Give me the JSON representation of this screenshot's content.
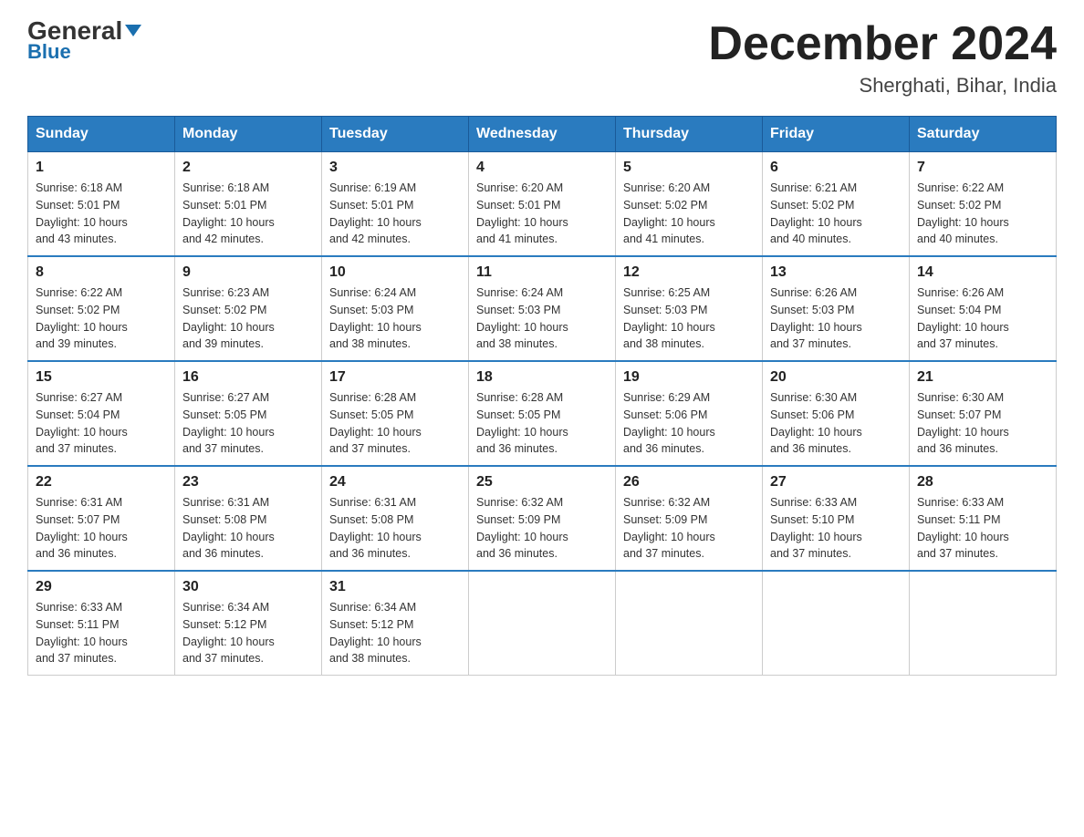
{
  "logo": {
    "general": "General",
    "blue": "Blue"
  },
  "title": "December 2024",
  "location": "Sherghati, Bihar, India",
  "weekdays": [
    "Sunday",
    "Monday",
    "Tuesday",
    "Wednesday",
    "Thursday",
    "Friday",
    "Saturday"
  ],
  "weeks": [
    [
      {
        "day": "1",
        "sunrise": "6:18 AM",
        "sunset": "5:01 PM",
        "daylight": "10 hours and 43 minutes."
      },
      {
        "day": "2",
        "sunrise": "6:18 AM",
        "sunset": "5:01 PM",
        "daylight": "10 hours and 42 minutes."
      },
      {
        "day": "3",
        "sunrise": "6:19 AM",
        "sunset": "5:01 PM",
        "daylight": "10 hours and 42 minutes."
      },
      {
        "day": "4",
        "sunrise": "6:20 AM",
        "sunset": "5:01 PM",
        "daylight": "10 hours and 41 minutes."
      },
      {
        "day": "5",
        "sunrise": "6:20 AM",
        "sunset": "5:02 PM",
        "daylight": "10 hours and 41 minutes."
      },
      {
        "day": "6",
        "sunrise": "6:21 AM",
        "sunset": "5:02 PM",
        "daylight": "10 hours and 40 minutes."
      },
      {
        "day": "7",
        "sunrise": "6:22 AM",
        "sunset": "5:02 PM",
        "daylight": "10 hours and 40 minutes."
      }
    ],
    [
      {
        "day": "8",
        "sunrise": "6:22 AM",
        "sunset": "5:02 PM",
        "daylight": "10 hours and 39 minutes."
      },
      {
        "day": "9",
        "sunrise": "6:23 AM",
        "sunset": "5:02 PM",
        "daylight": "10 hours and 39 minutes."
      },
      {
        "day": "10",
        "sunrise": "6:24 AM",
        "sunset": "5:03 PM",
        "daylight": "10 hours and 38 minutes."
      },
      {
        "day": "11",
        "sunrise": "6:24 AM",
        "sunset": "5:03 PM",
        "daylight": "10 hours and 38 minutes."
      },
      {
        "day": "12",
        "sunrise": "6:25 AM",
        "sunset": "5:03 PM",
        "daylight": "10 hours and 38 minutes."
      },
      {
        "day": "13",
        "sunrise": "6:26 AM",
        "sunset": "5:03 PM",
        "daylight": "10 hours and 37 minutes."
      },
      {
        "day": "14",
        "sunrise": "6:26 AM",
        "sunset": "5:04 PM",
        "daylight": "10 hours and 37 minutes."
      }
    ],
    [
      {
        "day": "15",
        "sunrise": "6:27 AM",
        "sunset": "5:04 PM",
        "daylight": "10 hours and 37 minutes."
      },
      {
        "day": "16",
        "sunrise": "6:27 AM",
        "sunset": "5:05 PM",
        "daylight": "10 hours and 37 minutes."
      },
      {
        "day": "17",
        "sunrise": "6:28 AM",
        "sunset": "5:05 PM",
        "daylight": "10 hours and 37 minutes."
      },
      {
        "day": "18",
        "sunrise": "6:28 AM",
        "sunset": "5:05 PM",
        "daylight": "10 hours and 36 minutes."
      },
      {
        "day": "19",
        "sunrise": "6:29 AM",
        "sunset": "5:06 PM",
        "daylight": "10 hours and 36 minutes."
      },
      {
        "day": "20",
        "sunrise": "6:30 AM",
        "sunset": "5:06 PM",
        "daylight": "10 hours and 36 minutes."
      },
      {
        "day": "21",
        "sunrise": "6:30 AM",
        "sunset": "5:07 PM",
        "daylight": "10 hours and 36 minutes."
      }
    ],
    [
      {
        "day": "22",
        "sunrise": "6:31 AM",
        "sunset": "5:07 PM",
        "daylight": "10 hours and 36 minutes."
      },
      {
        "day": "23",
        "sunrise": "6:31 AM",
        "sunset": "5:08 PM",
        "daylight": "10 hours and 36 minutes."
      },
      {
        "day": "24",
        "sunrise": "6:31 AM",
        "sunset": "5:08 PM",
        "daylight": "10 hours and 36 minutes."
      },
      {
        "day": "25",
        "sunrise": "6:32 AM",
        "sunset": "5:09 PM",
        "daylight": "10 hours and 36 minutes."
      },
      {
        "day": "26",
        "sunrise": "6:32 AM",
        "sunset": "5:09 PM",
        "daylight": "10 hours and 37 minutes."
      },
      {
        "day": "27",
        "sunrise": "6:33 AM",
        "sunset": "5:10 PM",
        "daylight": "10 hours and 37 minutes."
      },
      {
        "day": "28",
        "sunrise": "6:33 AM",
        "sunset": "5:11 PM",
        "daylight": "10 hours and 37 minutes."
      }
    ],
    [
      {
        "day": "29",
        "sunrise": "6:33 AM",
        "sunset": "5:11 PM",
        "daylight": "10 hours and 37 minutes."
      },
      {
        "day": "30",
        "sunrise": "6:34 AM",
        "sunset": "5:12 PM",
        "daylight": "10 hours and 37 minutes."
      },
      {
        "day": "31",
        "sunrise": "6:34 AM",
        "sunset": "5:12 PM",
        "daylight": "10 hours and 38 minutes."
      },
      null,
      null,
      null,
      null
    ]
  ],
  "labels": {
    "sunrise": "Sunrise:",
    "sunset": "Sunset:",
    "daylight": "Daylight:"
  }
}
